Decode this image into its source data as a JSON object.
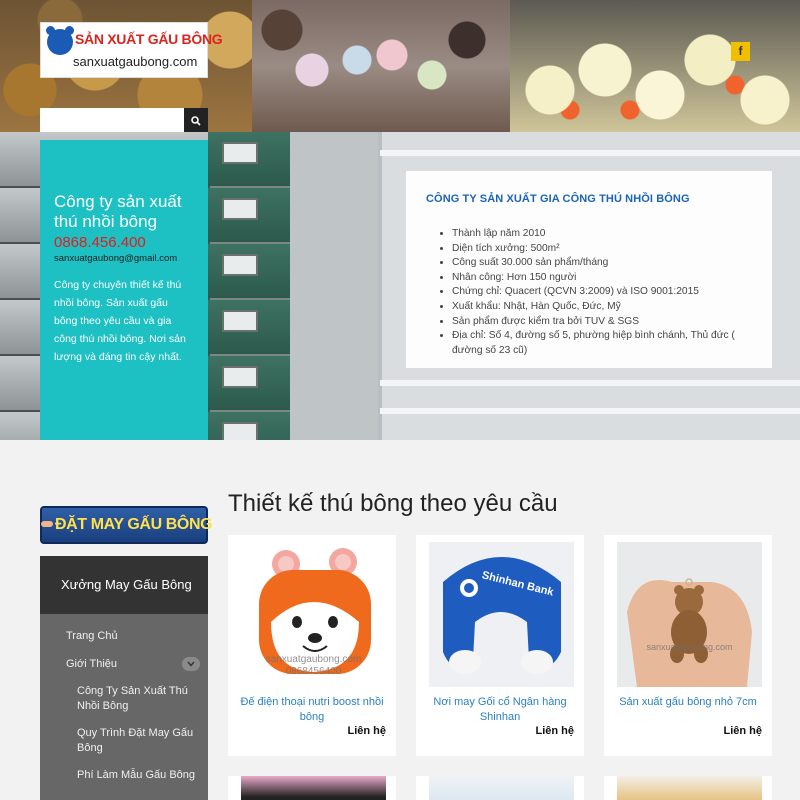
{
  "header": {
    "logo_title": "SẢN XUẤT GẤU BÔNG",
    "logo_url": "sanxuatgaubong.com",
    "facebook_icon": "facebook-icon",
    "facebook_glyph": "f"
  },
  "search": {
    "placeholder": "",
    "icon": "search-icon"
  },
  "company": {
    "name": "Công ty sản xuất thú nhồi bông",
    "phone": "0868.456.400",
    "email": "sanxuatgaubong@gmail.com",
    "description": "Công ty chuyên thiết kế thú nhồi bông. Sản xuất gấu bông theo yêu cầu và gia công thú nhồi bông. Nơi sản lượng và đáng tin cậy nhất."
  },
  "info": {
    "title": "CÔNG TY SẢN XUẤT GIA CÔNG THÚ NHỒI BÔNG",
    "items": [
      "Thành lập năm 2010",
      "Diện tích xưởng: 500m²",
      "Công suất 30.000 sản phẩm/tháng",
      "Nhân công: Hơn 150 người",
      "Chứng chỉ: Quacert (QCVN 3:2009) và ISO 9001:2015",
      "Xuất khẩu: Nhật, Hàn Quốc, Đức, Mỹ",
      "Sản phẩm được kiểm tra bởi TUV & SGS",
      "Địa chỉ: Số 4, đường số 5, phường hiệp bình chánh, Thủ đức ( đường số 23 cũ)"
    ]
  },
  "sidebar": {
    "order_banner": "ĐẶT MAY GẤU BÔNG",
    "menu_title": "Xưởng May Gấu Bông",
    "items": [
      {
        "label": "Trang Chủ"
      },
      {
        "label": "Giới Thiệu"
      },
      {
        "label": "Công Ty Sản Xuất Thú Nhồi Bông"
      },
      {
        "label": "Quy Trình Đặt May Gấu Bông"
      },
      {
        "label": "Phí Làm Mẫu Gấu Bông"
      }
    ]
  },
  "main": {
    "section_title": "Thiết kế thú bông theo yêu cầu",
    "products": [
      {
        "title": "Đế điện thoại nutri boost nhồi bông",
        "price": "Liên hệ",
        "watermark_1": "sanxuatgaubong.com",
        "watermark_2": "0868456400"
      },
      {
        "title": "Nơi may Gối cổ Ngân hàng Shinhan",
        "price": "Liên hệ",
        "brand_text": "Shinhan Bank"
      },
      {
        "title": "Sản xuất gấu bông nhỏ 7cm",
        "price": "Liên hệ",
        "watermark_1": "sanxuatgaubong.com"
      }
    ]
  },
  "colors": {
    "teal": "#1dc1c3",
    "phone_red": "#e51c1c",
    "link_blue": "#2a7fc1",
    "info_title_blue": "#1a64b8",
    "menu_gray": "#676767",
    "facebook_yellow": "#f0c000"
  }
}
